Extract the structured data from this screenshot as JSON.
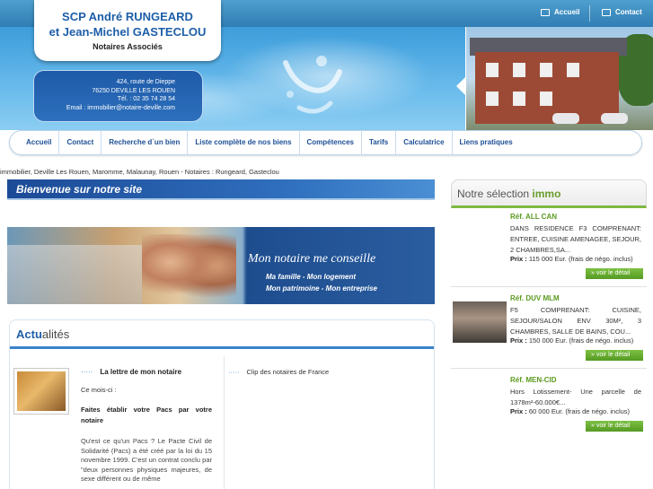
{
  "topbar": {
    "home_label": "Accueil",
    "contact_label": "Contact"
  },
  "header": {
    "title_line1": "SCP André RUNGEARD",
    "title_line2": "et Jean-Michel GASTECLOU",
    "subtitle": "Notaires Associés",
    "address": [
      "424, route de Dieppe",
      "76250 DEVILLE LES ROUEN",
      "Tél. : 02 35 74 28 54",
      "Email : immobilier@notaire-deville.com"
    ]
  },
  "nav": [
    "Accueil",
    "Contact",
    "Recherche d`un bien",
    "Liste complète de nos biens",
    "Compétences",
    "Tarifs",
    "Calculatrice",
    "Liens pratiques"
  ],
  "keywords": "immobilier, Deville Les Rouen, Maromme, Malaunay, Rouen - Notaires : Rungeard, Gasteclou",
  "welcome": "Bienvenue sur notre site",
  "banner": {
    "title": "Mon notaire me conseille",
    "line1": "Ma famille - Mon logement",
    "line2": "Mon patrimoine - Mon entreprise"
  },
  "news": {
    "heading_part1": "Actu",
    "heading_part2": "alités",
    "dots": "·····",
    "item1_title": "La lettre de mon notaire",
    "item1_sub": "Ce mois-ci :",
    "item1_headline": "Faites établir votre Pacs par votre notaire",
    "item1_body": "Qu'est ce qu'un Pacs ? Le Pacte Civil de Solidarité (Pacs) a été créé par la loi du 15 novembre 1999. C'est un contrat conclu par \"deux personnes physiques majeures, de sexe différent ou de même",
    "item2_title": "Clip des notaires de France"
  },
  "selection": {
    "heading_part1": "Notre sélection",
    "heading_part2": "immo",
    "listings": [
      {
        "ref": "Réf. ALL CAN",
        "desc": "DANS RESIDENCE F3 COMPRENANT: ENTREE, CUISINE AMENAGEE, SEJOUR, 2 CHAMBRES,SA...",
        "price_label": "Prix :",
        "price": "115 000",
        "currency": "Eur.",
        "fees": "(frais de négo. inclus)",
        "button": "voir le détail"
      },
      {
        "ref": "Réf. DUV MLM",
        "desc": "F5 COMPRENANT: CUISINE, SEJOUR/SALON ENV 30M², 3 CHAMBRES, SALLE DE BAINS, COU...",
        "price_label": "Prix :",
        "price": "150 000",
        "currency": "Eur.",
        "fees": "(frais de négo. inclus)",
        "button": "voir le détail"
      },
      {
        "ref": "Réf. MEN-CID",
        "desc": "Hors Lotissement- Une parcelle de 1378m²-60.000€...",
        "price_label": "Prix :",
        "price": "60 000",
        "currency": "Eur.",
        "fees": "(frais de négo. inclus)",
        "button": "voir le détail"
      }
    ]
  }
}
